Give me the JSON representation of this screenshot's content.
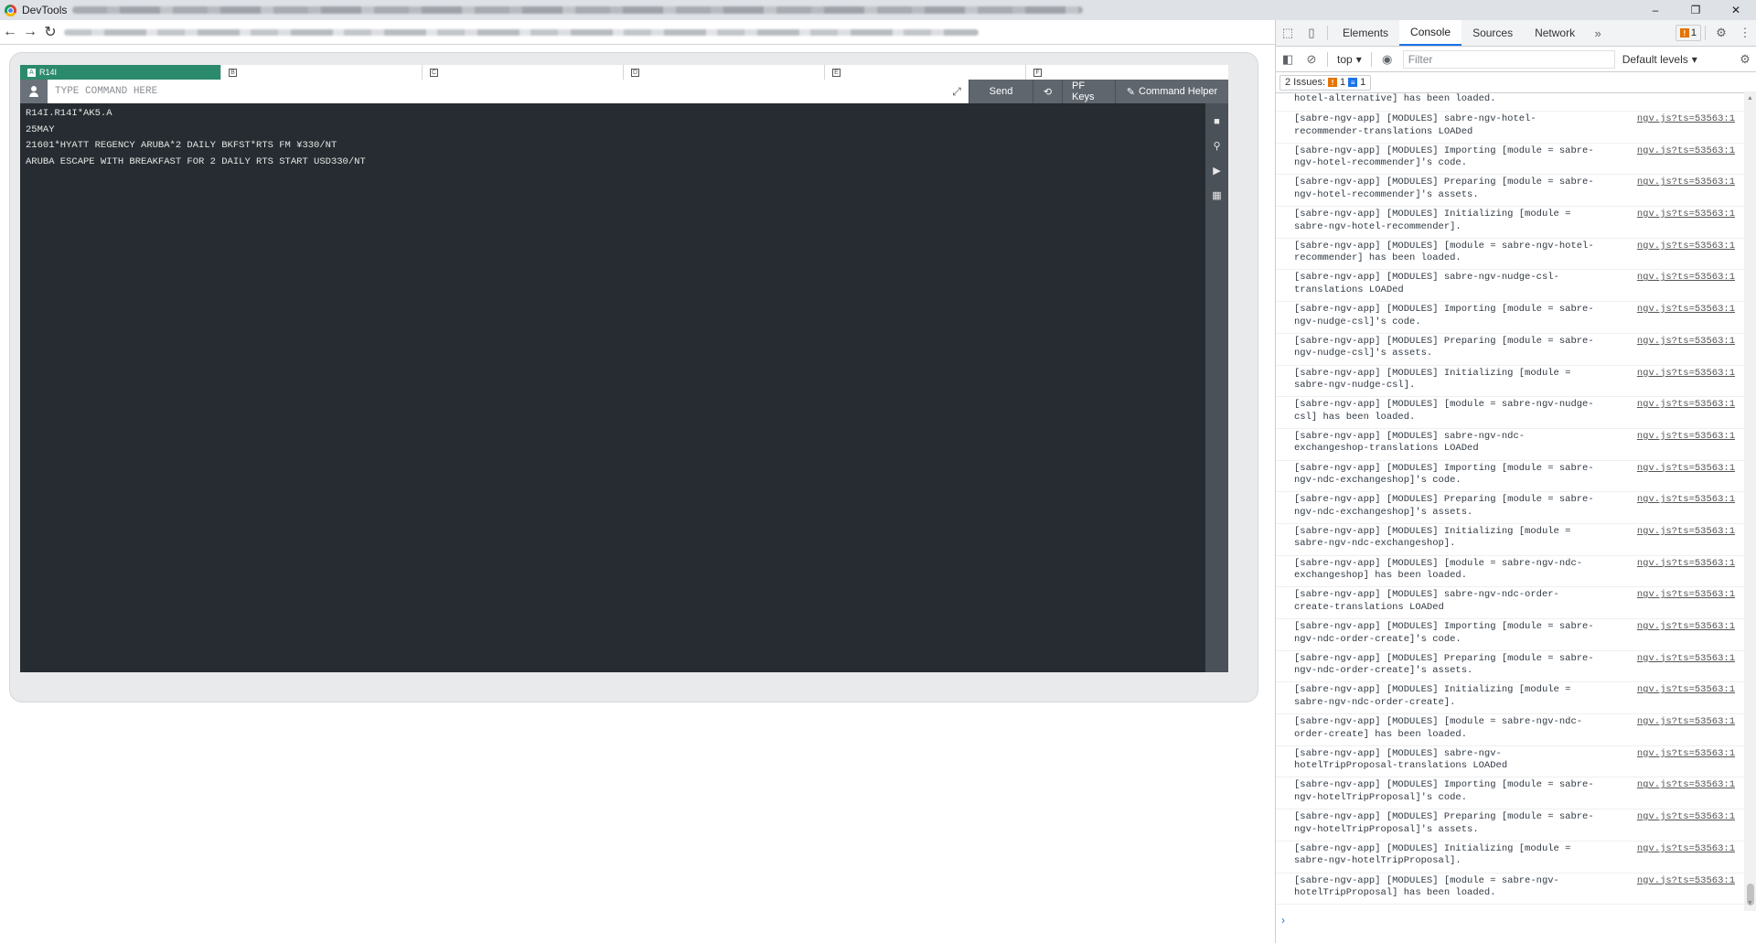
{
  "window": {
    "title": "DevTools",
    "controls": {
      "minimize": "–",
      "maximize": "❐",
      "close": "✕"
    }
  },
  "terminal": {
    "area_tabs": [
      {
        "letter": "A",
        "label": "R14I",
        "active": true
      },
      {
        "letter": "B",
        "label": ""
      },
      {
        "letter": "C",
        "label": ""
      },
      {
        "letter": "D",
        "label": ""
      },
      {
        "letter": "E",
        "label": ""
      },
      {
        "letter": "F",
        "label": ""
      }
    ],
    "command_placeholder": "TYPE COMMAND HERE",
    "buttons": {
      "send": "Send",
      "pf_keys": "PF Keys",
      "command_helper": "Command Helper"
    },
    "lines": [
      "R14I.R14I*AK5.A",
      "25MAY",
      "21601*HYATT REGENCY ARUBA*2 DAILY BKFST*RTS FM ¥330/NT",
      "ARUBA ESCAPE WITH BREAKFAST FOR 2 DAILY RTS START USD330/NT"
    ]
  },
  "devtools": {
    "tabs": [
      "Elements",
      "Console",
      "Sources",
      "Network"
    ],
    "active_tab": "Console",
    "more_tabs": "»",
    "issue_badge_count": "1",
    "context": "top",
    "filter_placeholder": "Filter",
    "levels": "Default levels",
    "issues_label": "2 Issues:",
    "issues_warn_count": "1",
    "issues_info_count": "1",
    "first_message": "hotel-alternative] has been loaded.",
    "messages": [
      {
        "text": "[sabre-ngv-app] [MODULES] sabre-ngv-hotel-recommender-translations LOADed",
        "src": "ngv.js?ts=53563:1"
      },
      {
        "text": "[sabre-ngv-app] [MODULES] Importing [module = sabre-ngv-hotel-recommender]'s code.",
        "src": "ngv.js?ts=53563:1"
      },
      {
        "text": "[sabre-ngv-app] [MODULES] Preparing [module = sabre-ngv-hotel-recommender]'s assets.",
        "src": "ngv.js?ts=53563:1"
      },
      {
        "text": "[sabre-ngv-app] [MODULES] Initializing [module = sabre-ngv-hotel-recommender].",
        "src": "ngv.js?ts=53563:1"
      },
      {
        "text": "[sabre-ngv-app] [MODULES] [module = sabre-ngv-hotel-recommender] has been loaded.",
        "src": "ngv.js?ts=53563:1"
      },
      {
        "text": "[sabre-ngv-app] [MODULES] sabre-ngv-nudge-csl-translations LOADed",
        "src": "ngv.js?ts=53563:1"
      },
      {
        "text": "[sabre-ngv-app] [MODULES] Importing [module = sabre-ngv-nudge-csl]'s code.",
        "src": "ngv.js?ts=53563:1"
      },
      {
        "text": "[sabre-ngv-app] [MODULES] Preparing [module = sabre-ngv-nudge-csl]'s assets.",
        "src": "ngv.js?ts=53563:1"
      },
      {
        "text": "[sabre-ngv-app] [MODULES] Initializing [module = sabre-ngv-nudge-csl].",
        "src": "ngv.js?ts=53563:1"
      },
      {
        "text": "[sabre-ngv-app] [MODULES] [module = sabre-ngv-nudge-csl] has been loaded.",
        "src": "ngv.js?ts=53563:1"
      },
      {
        "text": "[sabre-ngv-app] [MODULES] sabre-ngv-ndc-exchangeshop-translations LOADed",
        "src": "ngv.js?ts=53563:1"
      },
      {
        "text": "[sabre-ngv-app] [MODULES] Importing [module = sabre-ngv-ndc-exchangeshop]'s code.",
        "src": "ngv.js?ts=53563:1"
      },
      {
        "text": "[sabre-ngv-app] [MODULES] Preparing [module = sabre-ngv-ndc-exchangeshop]'s assets.",
        "src": "ngv.js?ts=53563:1"
      },
      {
        "text": "[sabre-ngv-app] [MODULES] Initializing [module = sabre-ngv-ndc-exchangeshop].",
        "src": "ngv.js?ts=53563:1"
      },
      {
        "text": "[sabre-ngv-app] [MODULES] [module = sabre-ngv-ndc-exchangeshop] has been loaded.",
        "src": "ngv.js?ts=53563:1"
      },
      {
        "text": "[sabre-ngv-app] [MODULES] sabre-ngv-ndc-order-create-translations LOADed",
        "src": "ngv.js?ts=53563:1"
      },
      {
        "text": "[sabre-ngv-app] [MODULES] Importing [module = sabre-ngv-ndc-order-create]'s code.",
        "src": "ngv.js?ts=53563:1"
      },
      {
        "text": "[sabre-ngv-app] [MODULES] Preparing [module = sabre-ngv-ndc-order-create]'s assets.",
        "src": "ngv.js?ts=53563:1"
      },
      {
        "text": "[sabre-ngv-app] [MODULES] Initializing [module = sabre-ngv-ndc-order-create].",
        "src": "ngv.js?ts=53563:1"
      },
      {
        "text": "[sabre-ngv-app] [MODULES] [module = sabre-ngv-ndc-order-create] has been loaded.",
        "src": "ngv.js?ts=53563:1"
      },
      {
        "text": "[sabre-ngv-app] [MODULES] sabre-ngv-hotelTripProposal-translations LOADed",
        "src": "ngv.js?ts=53563:1"
      },
      {
        "text": "[sabre-ngv-app] [MODULES] Importing [module = sabre-ngv-hotelTripProposal]'s code.",
        "src": "ngv.js?ts=53563:1"
      },
      {
        "text": "[sabre-ngv-app] [MODULES] Preparing [module = sabre-ngv-hotelTripProposal]'s assets.",
        "src": "ngv.js?ts=53563:1"
      },
      {
        "text": "[sabre-ngv-app] [MODULES] Initializing [module = sabre-ngv-hotelTripProposal].",
        "src": "ngv.js?ts=53563:1"
      },
      {
        "text": "[sabre-ngv-app] [MODULES] [module = sabre-ngv-hotelTripProposal] has been loaded.",
        "src": "ngv.js?ts=53563:1"
      }
    ],
    "prompt": "›"
  }
}
